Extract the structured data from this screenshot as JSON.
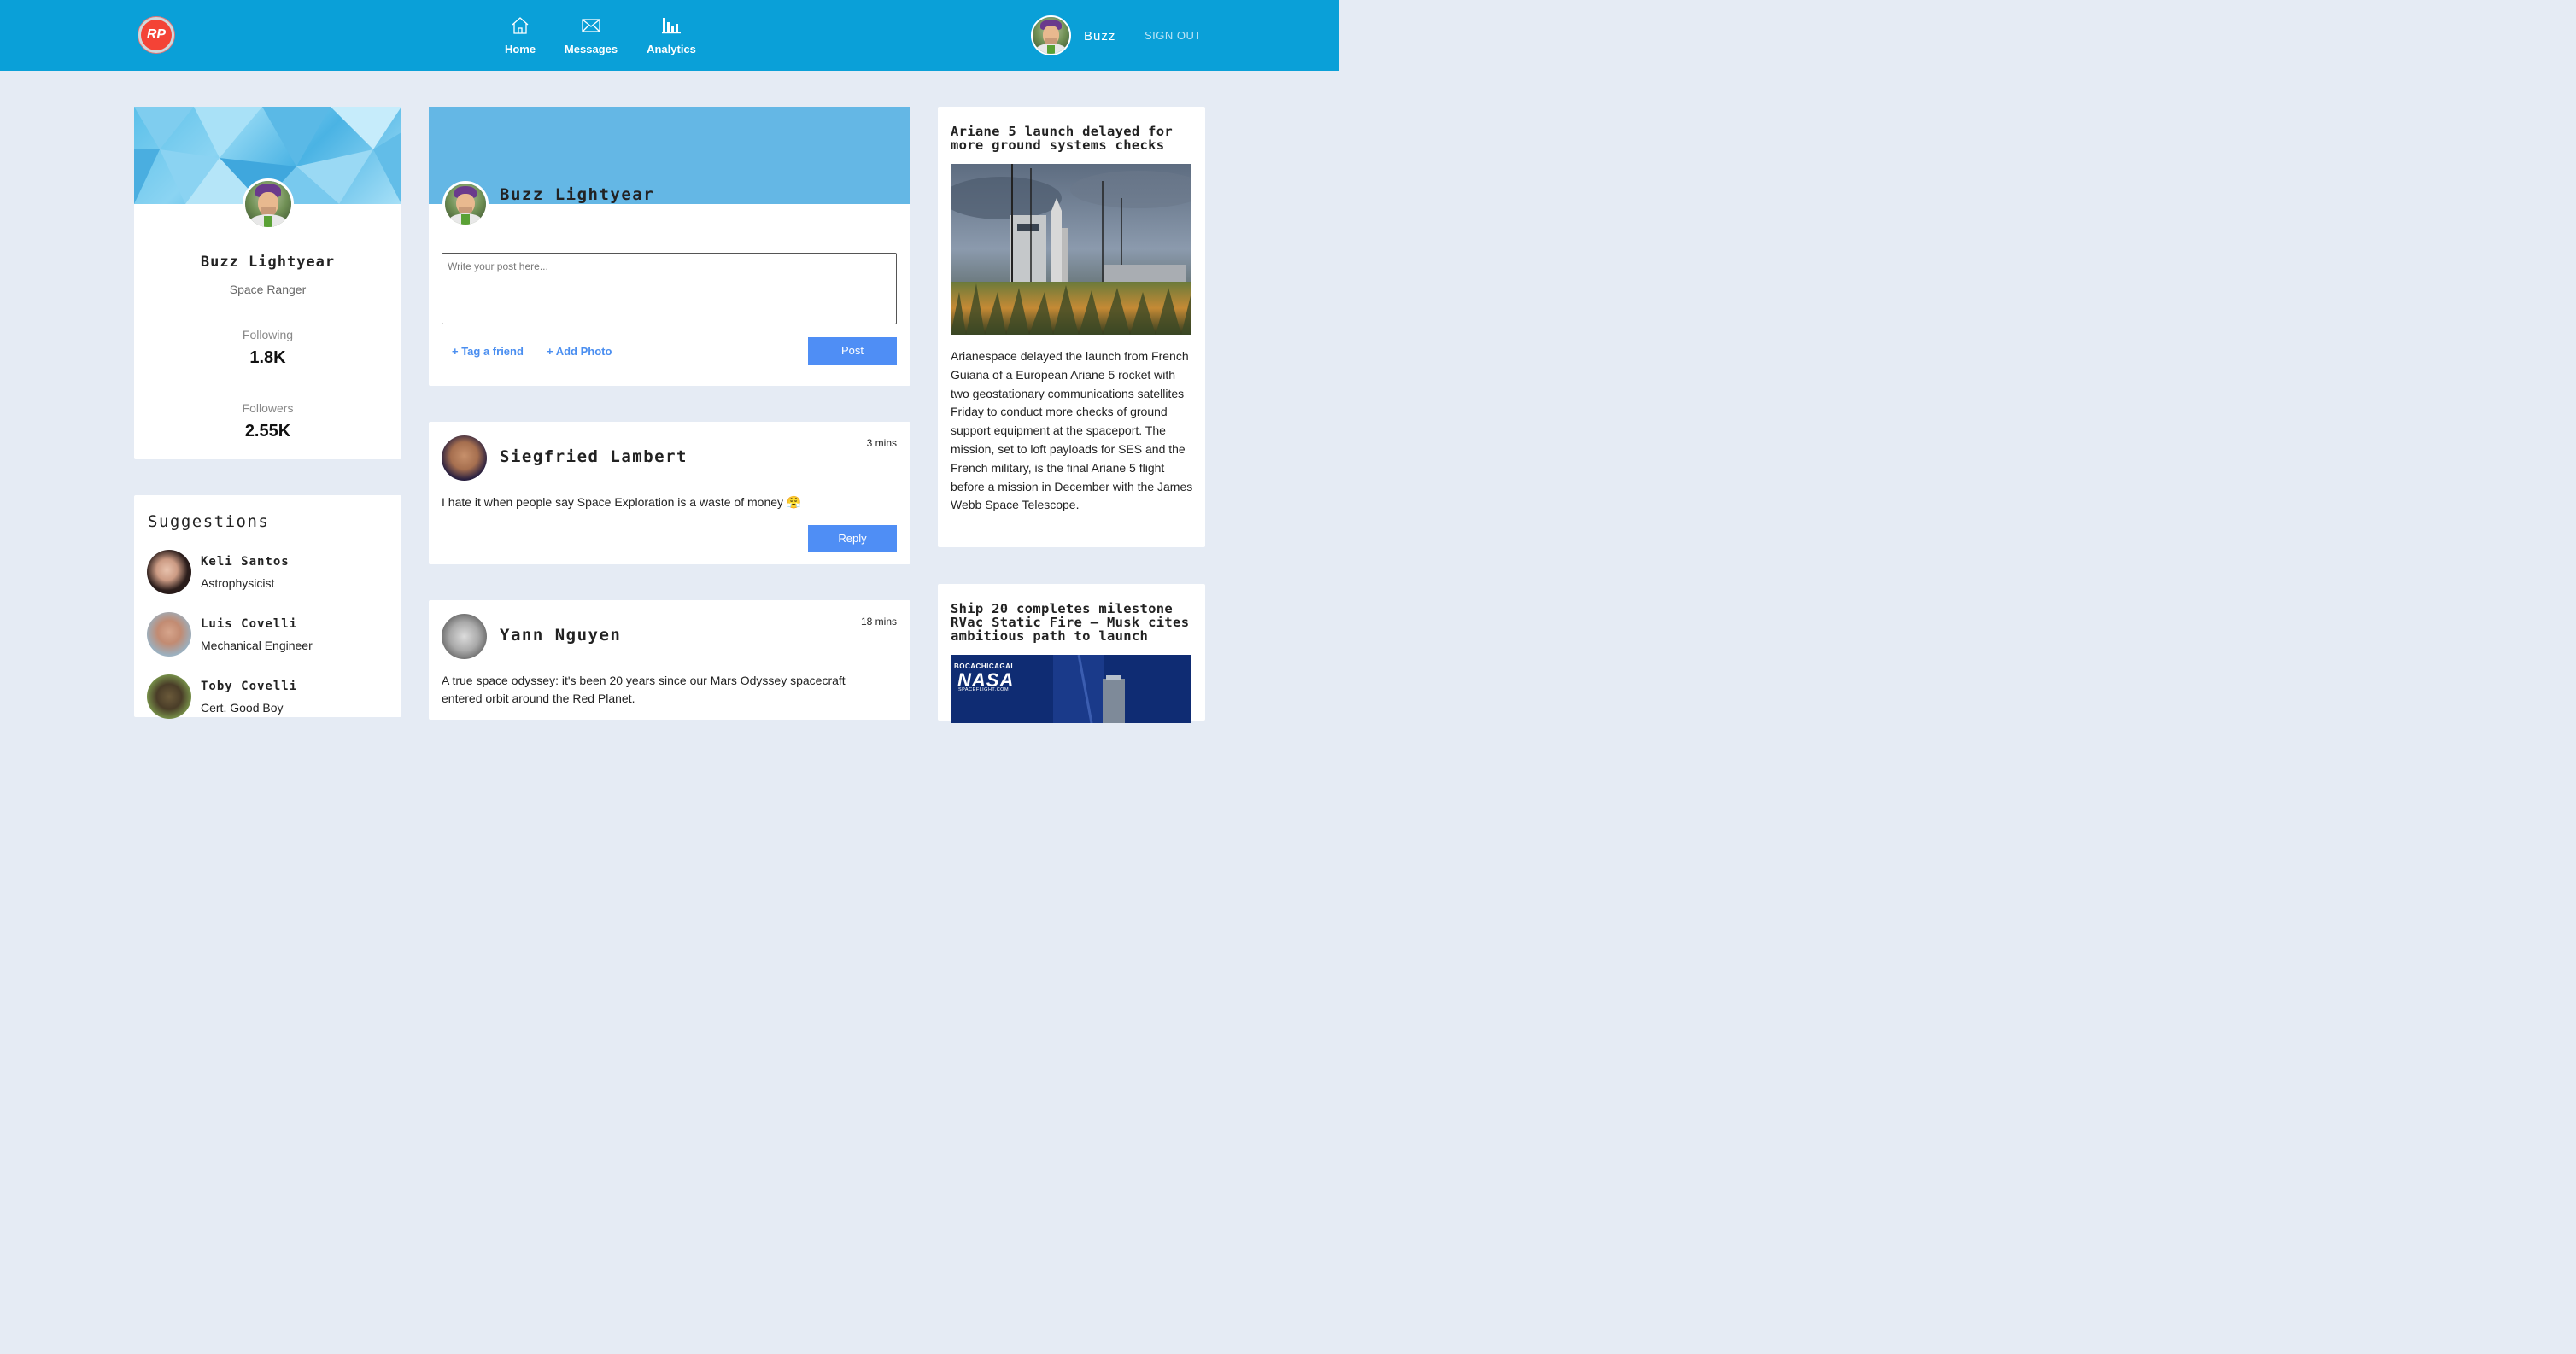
{
  "header": {
    "logo_text": "RP",
    "nav": [
      {
        "label": "Home",
        "icon": "home-icon"
      },
      {
        "label": "Messages",
        "icon": "envelope-icon"
      },
      {
        "label": "Analytics",
        "icon": "bar-chart-icon"
      }
    ],
    "username": "Buzz",
    "sign_out": "SIGN OUT",
    "colors": {
      "bar": "#0aa0d8",
      "logo": "#f44336"
    }
  },
  "profile": {
    "name": "Buzz Lightyear",
    "role": "Space Ranger",
    "following_label": "Following",
    "following_value": "1.8K",
    "followers_label": "Followers",
    "followers_value": "2.55K"
  },
  "suggestions": {
    "title": "Suggestions",
    "items": [
      {
        "name": "Keli Santos",
        "job": "Astrophysicist"
      },
      {
        "name": "Luis Covelli",
        "job": "Mechanical Engineer"
      },
      {
        "name": "Toby Covelli",
        "job": "Cert. Good Boy"
      }
    ]
  },
  "composer": {
    "name": "Buzz Lightyear",
    "placeholder": "Write your post here...",
    "tag_friend": "+ Tag a friend",
    "add_photo": "+ Add Photo",
    "post_button": "Post"
  },
  "posts": [
    {
      "author": "Siegfried Lambert",
      "time": "3 mins",
      "text": "I hate it when people say Space Exploration is a waste of money 😤",
      "reply": "Reply"
    },
    {
      "author": "Yann Nguyen",
      "time": "18 mins",
      "text": "A true space odyssey: it's been 20 years since our Mars Odyssey spacecraft entered orbit around the Red Planet."
    }
  ],
  "news": [
    {
      "title": "Ariane 5 launch delayed for more ground systems checks",
      "body": "Arianespace delayed the launch from French Guiana of a European Ariane 5 rocket with two geostationary communications satellites Friday to conduct more checks of ground support equipment at the spaceport. The mission, set to loft payloads for SES and the French military, is the final Ariane 5 flight before a mission in December with the James Webb Space Telescope."
    },
    {
      "title": "Ship 20 completes milestone RVac Static Fire – Musk cites ambitious path to launch",
      "image_text_1": "BocaChicaGal",
      "image_text_2": "NASA",
      "image_text_3": "SPACEFLIGHT.COM"
    }
  ]
}
